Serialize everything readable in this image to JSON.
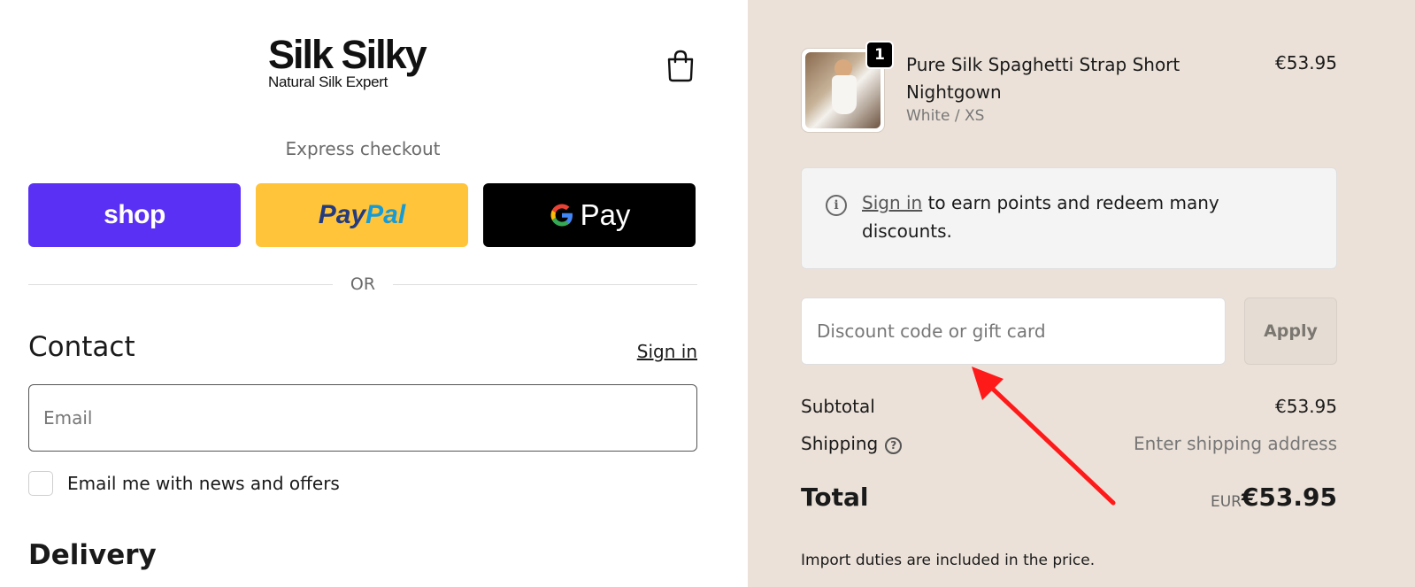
{
  "brand": {
    "logo_main": "Silk Silky",
    "logo_sub": "Natural Silk Expert"
  },
  "header": {
    "cart_icon": "shopping-bag-icon"
  },
  "express": {
    "title": "Express checkout",
    "shop_label": "shop",
    "paypal_label_a": "Pay",
    "paypal_label_b": "Pal",
    "gpay_label": "Pay",
    "divider": "OR"
  },
  "contact": {
    "heading": "Contact",
    "sign_in": "Sign in",
    "email_placeholder": "Email",
    "email_value": "",
    "newsletter_label": "Email me with news and offers",
    "newsletter_checked": false
  },
  "delivery": {
    "heading": "Delivery"
  },
  "order": {
    "item": {
      "name": "Pure Silk Spaghetti Strap Short Nightgown",
      "variant": "White / XS",
      "price": "€53.95",
      "quantity": "1"
    },
    "info": {
      "link": "Sign in",
      "text": " to earn points and redeem many discounts."
    },
    "discount": {
      "placeholder": "Discount code or gift card",
      "apply_label": "Apply"
    },
    "subtotal_label": "Subtotal",
    "subtotal_value": "€53.95",
    "shipping_label": "Shipping",
    "shipping_value": "Enter shipping address",
    "total_label": "Total",
    "currency": "EUR",
    "total_value": "€53.95",
    "duties_note": "Import duties are included in the price."
  },
  "colors": {
    "shop": "#5a31f4",
    "paypal": "#ffc439",
    "gpay": "#000000",
    "summary_bg": "#ebe1d8",
    "annotation_arrow": "#ff1a1a"
  }
}
